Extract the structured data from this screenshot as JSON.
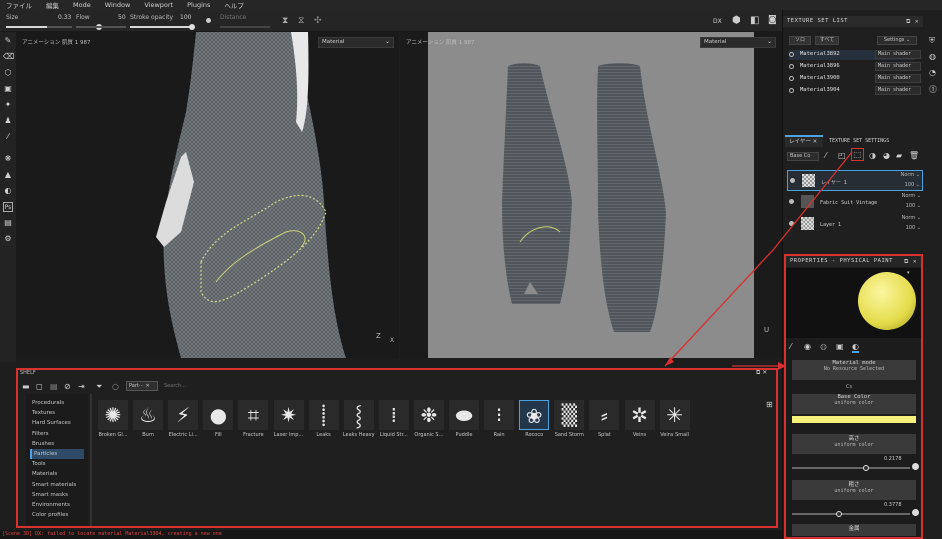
{
  "menu": [
    "ファイル",
    "編集",
    "Mode",
    "Window",
    "Viewport",
    "Plugins",
    "ヘルプ"
  ],
  "toolbar": {
    "size_label": "Size",
    "size_value": "0.33",
    "flow_label": "Flow",
    "flow_value": "50",
    "stroke_label": "Stroke opacity",
    "stroke_value": "100",
    "symmetry_label": "Distance",
    "size_fill": 0.45,
    "flow_fill": 0.5,
    "stroke_fill": 1.0
  },
  "viewport3d": {
    "title": "アニメーション 肌質 1 987",
    "material_select": "Material"
  },
  "viewport2d": {
    "title": "アニメーション 肌質 1 987",
    "material_select": "Material"
  },
  "texture_set_list": {
    "title": "TEXTURE SET LIST",
    "filter_a": "ソロ",
    "filter_b": "すべて",
    "settings": "Settings ⌄",
    "items": [
      {
        "name": "Material3892",
        "shader": "Main shader"
      },
      {
        "name": "Material3896",
        "shader": "Main shader"
      },
      {
        "name": "Material3900",
        "shader": "Main shader"
      },
      {
        "name": "Material3904",
        "shader": "Main shader"
      }
    ]
  },
  "layers_panel": {
    "tab_layers": "レイヤー",
    "tab_settings": "TEXTURE SET SETTINGS",
    "channel_select": "Base Co",
    "items": [
      {
        "name": "レイヤー 1",
        "blend": "Norm ⌄",
        "opacity": "100 ⌄"
      },
      {
        "name": "Fabric Suit Vintage",
        "blend": "Norm ⌄",
        "opacity": "100 ⌄"
      },
      {
        "name": "Layer 1",
        "blend": "Norm ⌄",
        "opacity": "100 ⌄"
      }
    ]
  },
  "properties": {
    "title": "PROPERTIES - PHYSICAL PAINT",
    "material_mode": "Material mode",
    "no_resource": "No Resource Selected",
    "small_label": "Cs",
    "base_color": "Base Color",
    "uniform1": "uniform color",
    "height_label": "高さ",
    "uniform2": "uniform color",
    "height_value": "0.2178",
    "height_level": 0.6,
    "rough_label": "粗さ",
    "uniform3": "uniform color",
    "rough_value": "0.3778",
    "rough_level": 0.37,
    "metal_label": "金属",
    "color_base": "#f5f07a"
  },
  "shelf": {
    "title": "SHELF",
    "filter_tag": "Part⋯",
    "search_placeholder": "Search...",
    "categories": [
      "Procedurals",
      "Textures",
      "Hard Surfaces",
      "Filters",
      "Brushes",
      "Particles",
      "Tools",
      "Materials",
      "Smart materials",
      "Smart masks",
      "Environments",
      "Color profiles"
    ],
    "selected_category": "Particles",
    "items": [
      "Broken Gl...",
      "Burn",
      "Electric Li...",
      "Fill",
      "Fracture",
      "Laser Imp...",
      "Leaks",
      "Leaks Heavy",
      "Liquid Str...",
      "Organic S...",
      "Puddle",
      "Rain",
      "Rococo",
      "Sand Storm",
      "Splat",
      "Veins",
      "Veins Small"
    ],
    "selected_item": "Rococo"
  },
  "status": {
    "message": "[Scene 3D] DX: failed to locate material Material3904, creating a new one"
  },
  "colors": {
    "highlight": "#d93030",
    "accent": "#4aa3e0",
    "selected_bg": "#2f4a66"
  }
}
